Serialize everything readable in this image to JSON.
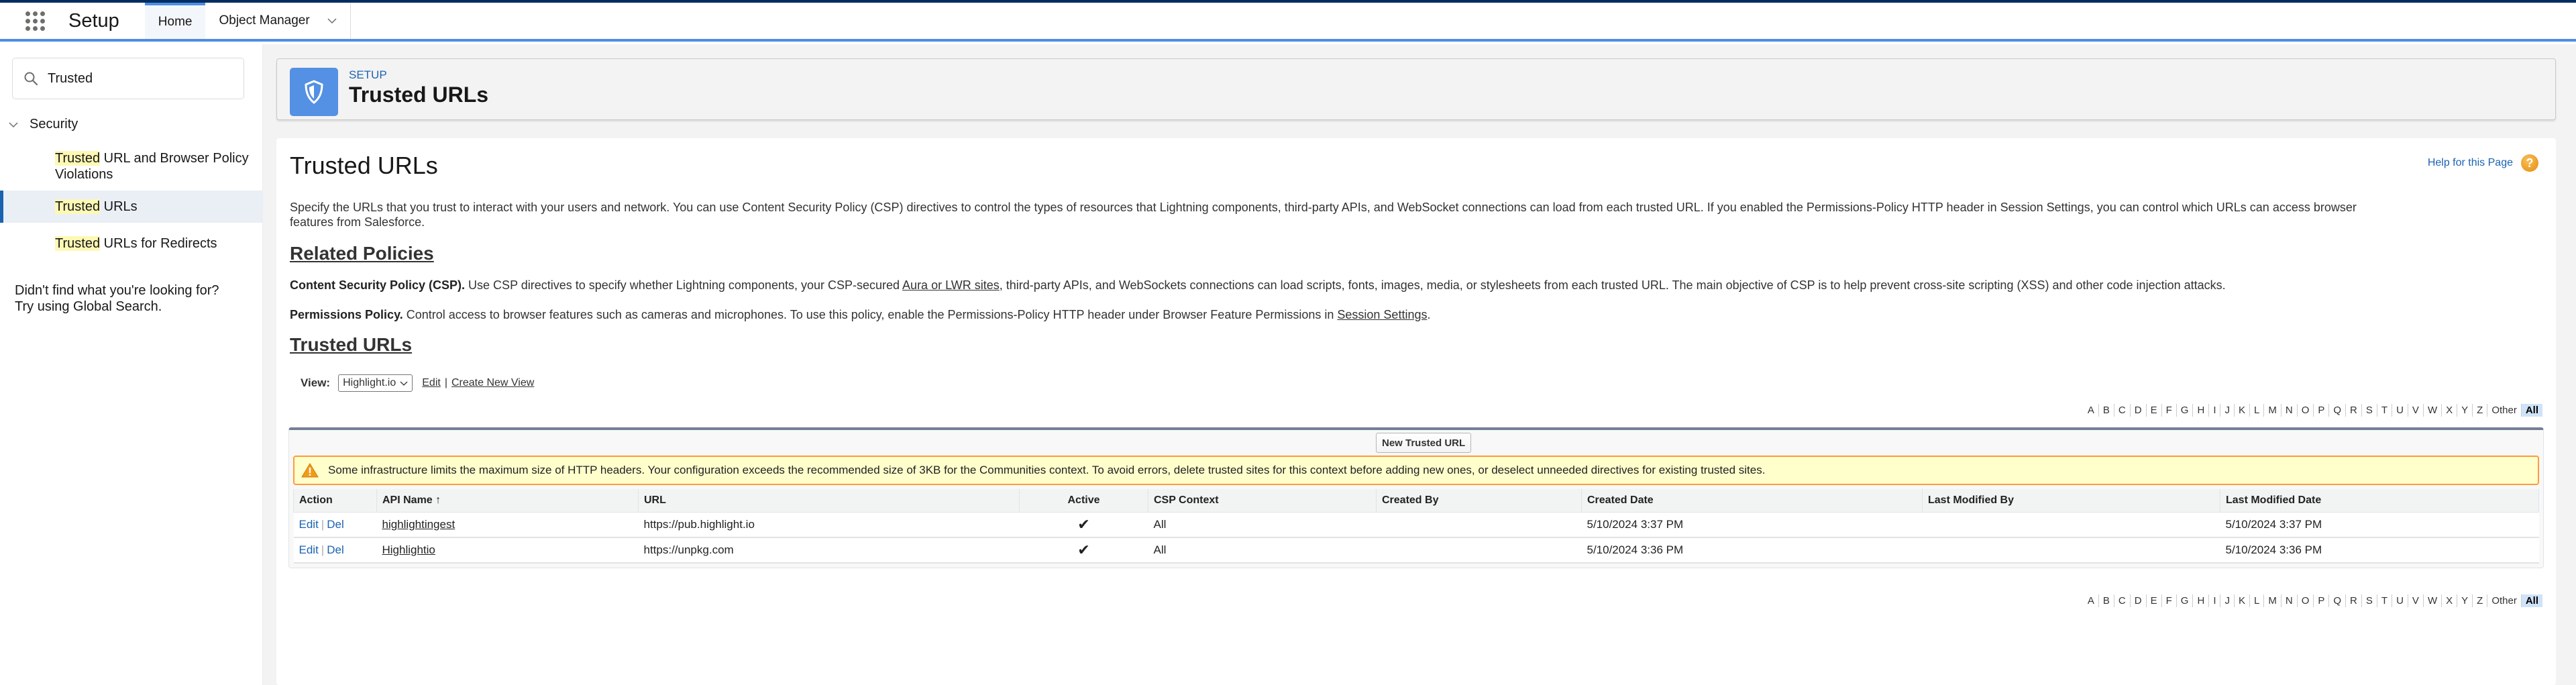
{
  "header": {
    "app_name": "Setup",
    "tabs": [
      {
        "label": "Home",
        "active": true
      },
      {
        "label": "Object Manager",
        "active": false
      }
    ]
  },
  "sidebar": {
    "search": {
      "value": "Trusted",
      "placeholder": "Quick Find"
    },
    "section": "Security",
    "highlight": "Trusted",
    "items": [
      {
        "rest_line1": " URL and Browser Policy",
        "rest_line2": "Violations",
        "selected": false
      },
      {
        "rest": " URLs",
        "selected": true
      },
      {
        "rest": " URLs for Redirects",
        "selected": false
      }
    ],
    "not_found_line1": "Didn't find what you're looking for?",
    "not_found_line2": "Try using Global Search."
  },
  "page_header": {
    "eyebrow": "SETUP",
    "title": "Trusted URLs",
    "icon": "shield-icon"
  },
  "content": {
    "title": "Trusted URLs",
    "help_link": "Help for this Page",
    "intro_line1": "Specify the URLs that you trust to interact with your users and network. You can use Content Security Policy (CSP) directives to control the types of resources that Lightning components, third-party APIs, and WebSocket connections can load from each trusted URL. If you enabled the Permissions-Policy HTTP header in Session Settings, you can control which URLs can access browser",
    "intro_line2": "features from Salesforce.",
    "related_heading": "Related Policies",
    "csp": {
      "label": "Content Security Policy (CSP).",
      "text_before": " Use CSP directives to specify whether Lightning components, your CSP-secured ",
      "link": "Aura or LWR sites",
      "text_after": ", third-party APIs, and WebSockets connections can load scripts, fonts, images, media, or stylesheets from each trusted URL. The main objective of CSP is to help prevent cross-site scripting (XSS) and other code injection attacks."
    },
    "permissions": {
      "label": "Permissions Policy.",
      "text_before": " Control access to browser features such as cameras and microphones. To use this policy, enable the Permissions-Policy HTTP header under Browser Feature Permissions in ",
      "link": "Session Settings",
      "text_after": "."
    },
    "list_heading": "Trusted URLs",
    "view": {
      "label": "View:",
      "selected": "Highlight.io",
      "edit": "Edit",
      "sep": "|",
      "create": "Create New View"
    },
    "rolodex": [
      "A",
      "B",
      "C",
      "D",
      "E",
      "F",
      "G",
      "H",
      "I",
      "J",
      "K",
      "L",
      "M",
      "N",
      "O",
      "P",
      "Q",
      "R",
      "S",
      "T",
      "U",
      "V",
      "W",
      "X",
      "Y",
      "Z",
      "Other",
      "All"
    ],
    "rolodex_selected": "All",
    "new_button": "New Trusted URL",
    "warning": "Some infrastructure limits the maximum size of HTTP headers. Your configuration exceeds the recommended size of 3KB for the Communities context. To avoid errors, delete trusted sites for this context before adding new ones, or deselect unneeded directives for existing trusted sites.",
    "table": {
      "columns": [
        "Action",
        "API Name ↑",
        "URL",
        "Active",
        "CSP Context",
        "Created By",
        "Created Date",
        "Last Modified By",
        "Last Modified Date"
      ],
      "rows": [
        {
          "edit": "Edit",
          "del": "Del",
          "api_name": "highlightingest",
          "url": "https://pub.highlight.io",
          "active": "✔",
          "csp_context": "All",
          "created_by": "",
          "created_date": "5/10/2024 3:37 PM",
          "last_modified_by": "",
          "last_modified_date": "5/10/2024 3:37 PM"
        },
        {
          "edit": "Edit",
          "del": "Del",
          "api_name": "Highlightio",
          "url": "https://unpkg.com",
          "active": "✔",
          "csp_context": "All",
          "created_by": "",
          "created_date": "5/10/2024 3:36 PM",
          "last_modified_by": "",
          "last_modified_date": "5/10/2024 3:36 PM"
        }
      ]
    }
  }
}
